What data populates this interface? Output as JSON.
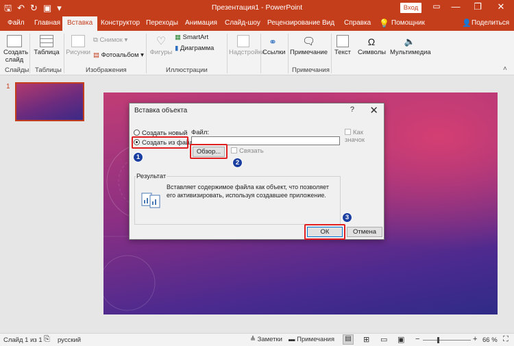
{
  "titlebar": {
    "title": "Презентация1  -  PowerPoint",
    "login_button": "Вход",
    "minimize_glyph": "—",
    "restore_glyph": "❐",
    "close_glyph": "✕"
  },
  "tabs": [
    "Файл",
    "Главная",
    "Вставка",
    "Конструктор",
    "Переходы",
    "Анимация",
    "Слайд-шоу",
    "Рецензирование",
    "Вид",
    "Справка",
    "Помощник",
    "Поделиться"
  ],
  "ribbon": {
    "new_slide": "Создать слайд",
    "table": "Таблица",
    "pictures": "Рисунки",
    "screenshot": "Снимок",
    "album": "Фотоальбом",
    "shapes": "Фигуры",
    "smartart": "SmartArt",
    "chart": "Диаграмма",
    "addins": "Надстройки",
    "links": "Ссылки",
    "comment": "Примечание",
    "text": "Текст",
    "symbols": "Символы",
    "multimedia": "Мультимедиа",
    "groups": {
      "slides": "Слайды",
      "tables": "Таблицы",
      "images": "Изображения",
      "illustrations": "Иллюстрации",
      "comments": "Примечания"
    }
  },
  "sidebar": {
    "slide_number": "1"
  },
  "dialog": {
    "title": "Вставка объекта",
    "help": "?",
    "close": "✕",
    "option_new": "Создать новый",
    "option_from_file": "Создать из файла",
    "file_label": "Файл:",
    "file_value": "",
    "browse": "Обзор...",
    "link": "Связать",
    "as_icon": "Как значок",
    "result_title": "Результат",
    "result_text": "Вставляет содержимое файла как объект, что позволяет его активизировать, используя создавшее приложение.",
    "ok": "ОК",
    "cancel": "Отмена"
  },
  "badges": [
    "1",
    "2",
    "3"
  ],
  "statusbar": {
    "slide_info": "Слайд 1 из 1",
    "language": "русский",
    "notes": "Заметки",
    "comments": "Примечания",
    "zoom_minus": "−",
    "zoom_plus": "+",
    "zoom": "66 %",
    "zoom_level": 0.66
  },
  "colors": {
    "accent": "#c43e1c",
    "highlight": "#e02020",
    "badge": "#1a3fa0"
  }
}
